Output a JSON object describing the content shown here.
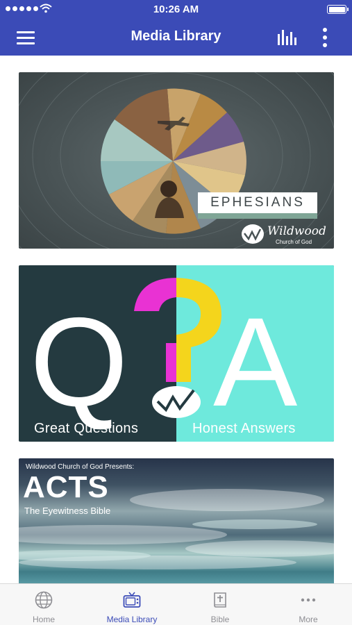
{
  "status_bar": {
    "time": "10:26 AM"
  },
  "nav": {
    "title": "Media Library",
    "icons": [
      "menu-icon",
      "bars-icon",
      "more-vertical-icon"
    ]
  },
  "media": [
    {
      "series_title": "EPHESIANS",
      "logo_text": "Wildwood",
      "logo_subtext": "Church of God"
    },
    {
      "big_left": "Q",
      "big_right": "A",
      "caption_left": "Great Questions",
      "caption_right": "Honest Answers"
    },
    {
      "presenter": "Wildwood Church of God Presents:",
      "series_title": "ACTS",
      "subtitle": "The Eyewitness Bible"
    }
  ],
  "tabs": [
    {
      "label": "Home",
      "icon": "globe-icon"
    },
    {
      "label": "Media Library",
      "icon": "tv-icon",
      "active": true
    },
    {
      "label": "Bible",
      "icon": "bible-icon"
    },
    {
      "label": "More",
      "icon": "more-horizontal-icon"
    }
  ],
  "colors": {
    "brand": "#3b4bb7",
    "tab_inactive": "#8e8e93",
    "qa_dark": "#243a40",
    "qa_teal": "#6ee9dc",
    "qa_magenta": "#e932d3",
    "qa_yellow": "#f4d51c"
  }
}
